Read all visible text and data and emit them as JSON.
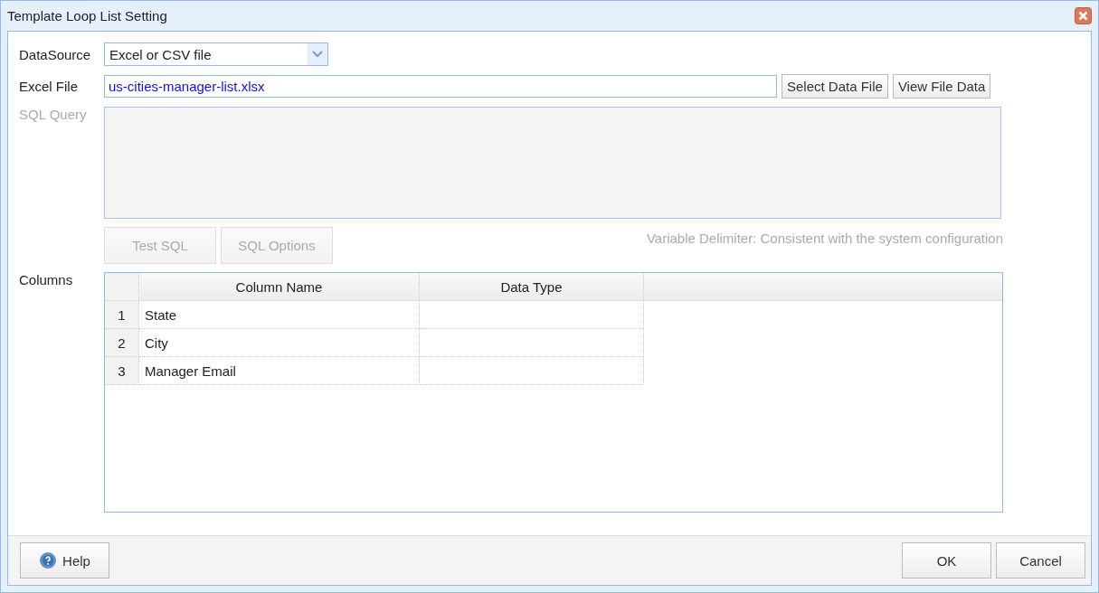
{
  "window": {
    "title": "Template Loop List Setting"
  },
  "datasource": {
    "label": "DataSource",
    "value": "Excel or CSV file"
  },
  "excel_file": {
    "label": "Excel File",
    "value": "us-cities-manager-list.xlsx"
  },
  "file_buttons": [
    {
      "label": "Select Data File",
      "disabled": false
    },
    {
      "label": "View File Data",
      "disabled": false
    }
  ],
  "sql_query": {
    "label": "SQL Query",
    "disabled": true
  },
  "sql_buttons": [
    {
      "label": "Test SQL",
      "disabled": true
    },
    {
      "label": "SQL Options",
      "disabled": true
    }
  ],
  "delimiter_note": "Variable Delimiter: Consistent with the system configuration",
  "columns": {
    "label": "Columns",
    "headers": [
      "Column Name",
      "Data Type"
    ],
    "rows": [
      {
        "number": "1",
        "name": "State"
      },
      {
        "number": "2",
        "name": "City"
      },
      {
        "number": "3",
        "name": "Manager Email"
      }
    ]
  },
  "footer": {
    "help": "Help",
    "ok": "OK",
    "cancel": "Cancel"
  }
}
